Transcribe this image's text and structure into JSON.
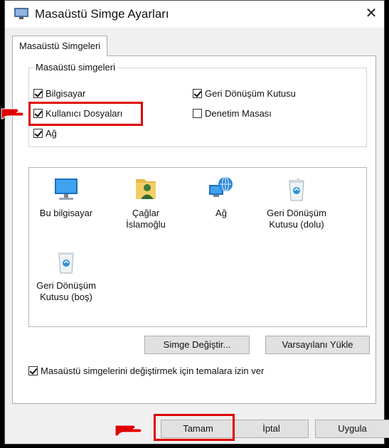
{
  "window": {
    "title": "Masaüstü Simge Ayarları",
    "close_glyph": "✕"
  },
  "tab": {
    "label": "Masaüstü Simgeleri"
  },
  "group": {
    "legend": "Masaüstü simgeleri",
    "checkboxes": [
      {
        "label": "Bilgisayar",
        "checked": true
      },
      {
        "label": "Geri Dönüşüm Kutusu",
        "checked": true
      },
      {
        "label": "Kullanıcı Dosyaları",
        "checked": true
      },
      {
        "label": "Denetim Masası",
        "checked": false
      },
      {
        "label": "Ağ",
        "checked": true
      }
    ]
  },
  "icons": [
    {
      "label": "Bu bilgisayar",
      "icon": "monitor-icon"
    },
    {
      "label": "Çağlar İslamoğlu",
      "icon": "user-folder-icon"
    },
    {
      "label": "Ağ",
      "icon": "network-globe-icon"
    },
    {
      "label": "Geri Dönüşüm Kutusu (dolu)",
      "icon": "recycle-bin-full-icon"
    },
    {
      "label": "Geri Dönüşüm Kutusu (boş)",
      "icon": "recycle-bin-empty-icon"
    }
  ],
  "buttons": {
    "change_icon": "Simge Değiştir...",
    "restore_default": "Varsayılanı Yükle",
    "ok": "Tamam",
    "cancel": "İptal",
    "apply": "Uygula"
  },
  "theme_checkbox": {
    "label": "Masaüstü simgelerini değiştirmek için temalara izin ver",
    "checked": true
  },
  "colors": {
    "highlight": "#e00000",
    "pointer_hand": "#e00000"
  }
}
